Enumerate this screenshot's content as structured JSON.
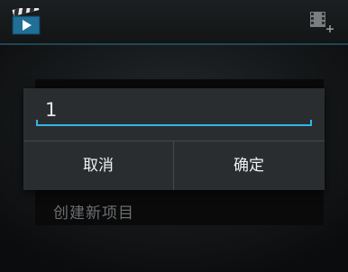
{
  "action_bar": {
    "app_icon": "clapperboard-play-icon",
    "action_icon": "add-clip-icon"
  },
  "dialog": {
    "input_value": "1",
    "cancel_label": "取消",
    "ok_label": "确定"
  },
  "list": {
    "items": [
      {
        "label": "创建新项目"
      }
    ]
  },
  "colors": {
    "accent": "#33b5e5",
    "dialog_background": "#2a2d2f",
    "text_primary": "#f1f1f1",
    "text_secondary": "#6b6f72"
  }
}
